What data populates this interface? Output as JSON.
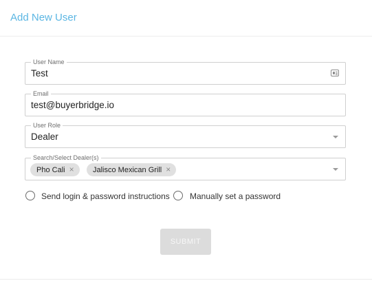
{
  "header": {
    "title": "Add New User"
  },
  "form": {
    "user_name": {
      "label": "User Name",
      "value": "Test",
      "icon": "contact-card-icon"
    },
    "email": {
      "label": "Email",
      "value": "test@buyerbridge.io"
    },
    "user_role": {
      "label": "User Role",
      "value": "Dealer",
      "icon": "chevron-down-icon"
    },
    "dealers": {
      "label": "Search/Select Dealer(s)",
      "chips": [
        "Pho Cali",
        "Jalisco Mexican Grill"
      ],
      "remove_glyph": "×",
      "icon": "chevron-down-icon"
    },
    "password_options": [
      {
        "label": "Send login & password instructions",
        "selected": false
      },
      {
        "label": "Manually set a password",
        "selected": false
      }
    ],
    "submit_label": "SUBMIT"
  },
  "colors": {
    "accent": "#5bb6e3",
    "border": "#cfcfcf",
    "chip_bg": "#e0e0e0",
    "submit_disabled_bg": "#dcdcdc"
  }
}
